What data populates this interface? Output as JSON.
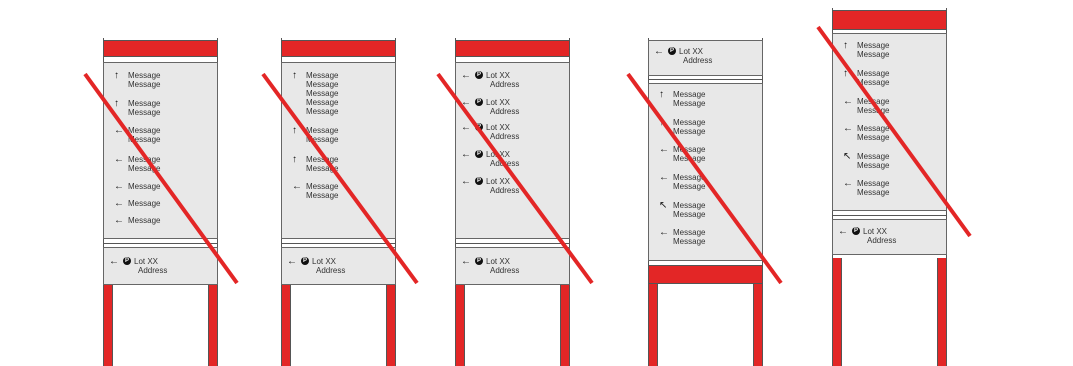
{
  "signs": [
    {
      "id": "sign-1",
      "top_rows": [
        {
          "arrow": "↑",
          "lines": [
            "Message",
            "Message"
          ]
        },
        {
          "arrow": "↑",
          "lines": [
            "Message",
            "Message"
          ]
        },
        {
          "arrow": "←",
          "lines": [
            "Message",
            "Message"
          ]
        },
        {
          "arrow": "←",
          "lines": [
            "Message",
            "Message"
          ]
        },
        {
          "arrow": "←",
          "lines": [
            "Message"
          ]
        },
        {
          "arrow": "←",
          "lines": [
            "Message"
          ]
        },
        {
          "arrow": "←",
          "lines": [
            "Message"
          ]
        }
      ],
      "bottom_rows": [
        {
          "arrow": "←",
          "parking": "P",
          "lines": [
            "Lot XX",
            "Address"
          ]
        }
      ]
    },
    {
      "id": "sign-2",
      "top_rows": [
        {
          "arrow": "↑",
          "lines": [
            "Message",
            "Message",
            "Message",
            "Message",
            "Message"
          ]
        },
        {
          "arrow": "↑",
          "lines": [
            "Message",
            "Message"
          ]
        },
        {
          "arrow": "↑",
          "lines": [
            "Message",
            "Message"
          ]
        },
        {
          "arrow": "←",
          "lines": [
            "Message",
            "Message"
          ]
        }
      ],
      "bottom_rows": [
        {
          "arrow": "←",
          "parking": "P",
          "lines": [
            "Lot XX",
            "Address"
          ]
        }
      ]
    },
    {
      "id": "sign-3",
      "top_rows": [
        {
          "arrow": "←",
          "parking": "P",
          "lines": [
            "Lot XX",
            "Address"
          ]
        },
        {
          "arrow": "←",
          "parking": "P",
          "lines": [
            "Lot XX",
            "Address"
          ]
        },
        {
          "arrow": "←",
          "parking": "P",
          "lines": [
            "Lot XX",
            "Address"
          ]
        },
        {
          "arrow": "←",
          "parking": "P",
          "lines": [
            "Lot XX",
            "Address"
          ]
        },
        {
          "arrow": "←",
          "parking": "P",
          "lines": [
            "Lot XX",
            "Address"
          ]
        }
      ],
      "bottom_rows": [
        {
          "arrow": "←",
          "parking": "P",
          "lines": [
            "Lot XX",
            "Address"
          ]
        }
      ]
    },
    {
      "id": "sign-4",
      "top_rows": [
        {
          "arrow": "←",
          "parking": "P",
          "lines": [
            "Lot XX",
            "Address"
          ]
        }
      ],
      "bottom_rows": [
        {
          "arrow": "↑",
          "lines": [
            "Message",
            "Message"
          ]
        },
        {
          "arrow": "↑",
          "lines": [
            "Message",
            "Message"
          ]
        },
        {
          "arrow": "←",
          "lines": [
            "Message",
            "Message"
          ]
        },
        {
          "arrow": "←",
          "lines": [
            "Message",
            "Message"
          ]
        },
        {
          "arrow": "↖",
          "lines": [
            "Message",
            "Message"
          ]
        },
        {
          "arrow": "←",
          "lines": [
            "Message",
            "Message"
          ]
        }
      ]
    },
    {
      "id": "sign-5",
      "top_rows": [
        {
          "arrow": "↑",
          "lines": [
            "Message",
            "Message"
          ]
        },
        {
          "arrow": "↑",
          "lines": [
            "Message",
            "Message"
          ]
        },
        {
          "arrow": "←",
          "lines": [
            "Message",
            "Message"
          ]
        },
        {
          "arrow": "←",
          "lines": [
            "Message",
            "Message"
          ]
        },
        {
          "arrow": "↖",
          "lines": [
            "Message",
            "Message"
          ]
        },
        {
          "arrow": "←",
          "lines": [
            "Message",
            "Message"
          ]
        }
      ],
      "bottom_rows": [
        {
          "arrow": "←",
          "parking": "P",
          "lines": [
            "Lot XX",
            "Address"
          ]
        }
      ]
    }
  ],
  "colors": {
    "red": "#e32626",
    "panel": "#e8e8e8",
    "outline": "#555555"
  }
}
